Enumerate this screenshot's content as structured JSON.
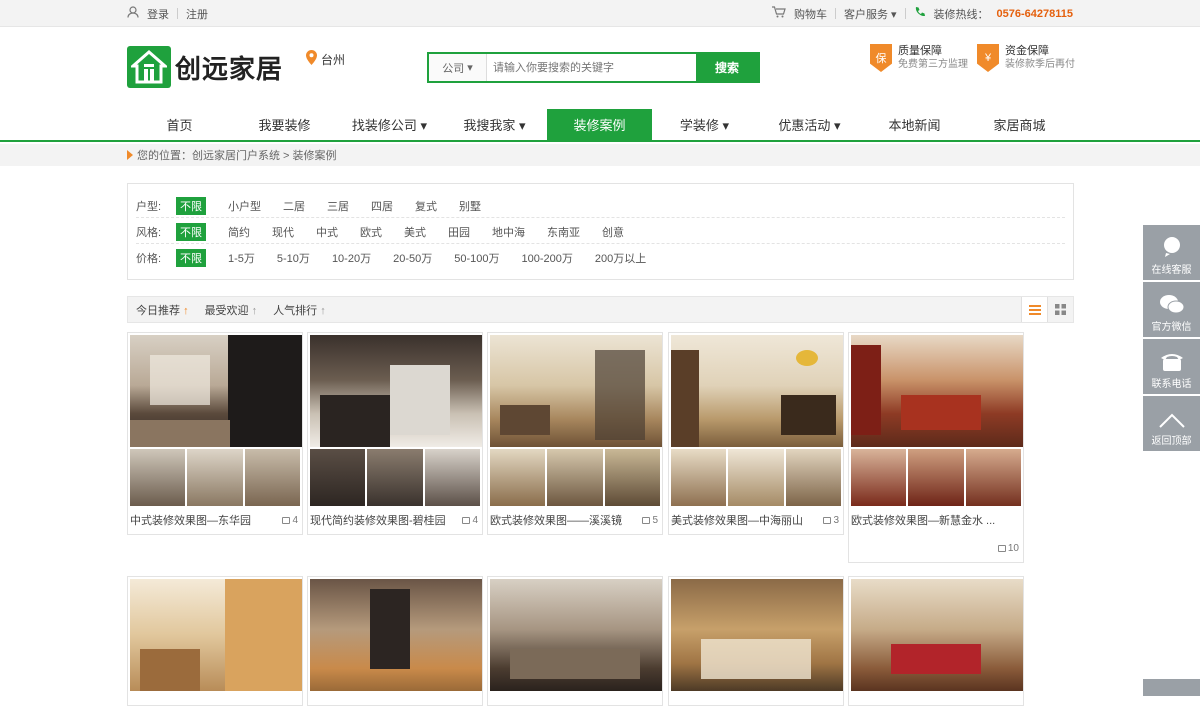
{
  "topbar": {
    "login": "登录",
    "register": "注册",
    "cart": "购物车",
    "service": "客户服务",
    "hotline_label": "装修热线：",
    "hotline_number": "0576-64278115"
  },
  "header": {
    "logo_text": "创远家居",
    "city": "台州",
    "search_type": "公司",
    "search_placeholder": "请输入你要搜索的关键字",
    "search_button": "搜索",
    "guarantees": [
      {
        "badge": "保",
        "title": "质量保障",
        "sub": "免费第三方监理"
      },
      {
        "badge": "¥",
        "title": "资金保障",
        "sub": "装修款季后再付"
      }
    ]
  },
  "nav": {
    "items": [
      "首页",
      "我要装修",
      "找装修公司 ▾",
      "我搜我家 ▾",
      "装修案例",
      "学装修 ▾",
      "优惠活动 ▾",
      "本地新闻",
      "家居商城"
    ],
    "active_index": 4
  },
  "breadcrumb": {
    "text": "您的位置：创远家居门户系统 > 装修案例"
  },
  "filters": [
    {
      "label": "户型:",
      "options": [
        "不限",
        "小户型",
        "二居",
        "三居",
        "四居",
        "复式",
        "别墅"
      ]
    },
    {
      "label": "风格:",
      "options": [
        "不限",
        "简约",
        "现代",
        "中式",
        "欧式",
        "美式",
        "田园",
        "地中海",
        "东南亚",
        "创意"
      ]
    },
    {
      "label": "价格:",
      "options": [
        "不限",
        "1-5万",
        "5-10万",
        "10-20万",
        "20-50万",
        "50-100万",
        "100-200万",
        "200万以上"
      ]
    }
  ],
  "sort": {
    "items": [
      "今日推荐",
      "最受欢迎",
      "人气排行"
    ]
  },
  "cases": [
    {
      "title": "中式装修效果图—东华园",
      "count": "4"
    },
    {
      "title": "现代简约装修效果图-碧桂园",
      "count": "4"
    },
    {
      "title": "欧式装修效果图——溪溪镜",
      "count": "5"
    },
    {
      "title": "美式装修效果图—中海丽山",
      "count": "3"
    },
    {
      "title": "欧式装修效果图—新慧金水 ...",
      "count": "10"
    }
  ],
  "side_tools": [
    "在线客服",
    "官方微信",
    "联系电话",
    "返回顶部"
  ],
  "colors": {
    "brand": "#1fa13d",
    "accent": "#f08a2a",
    "hotline": "#e5600d"
  }
}
